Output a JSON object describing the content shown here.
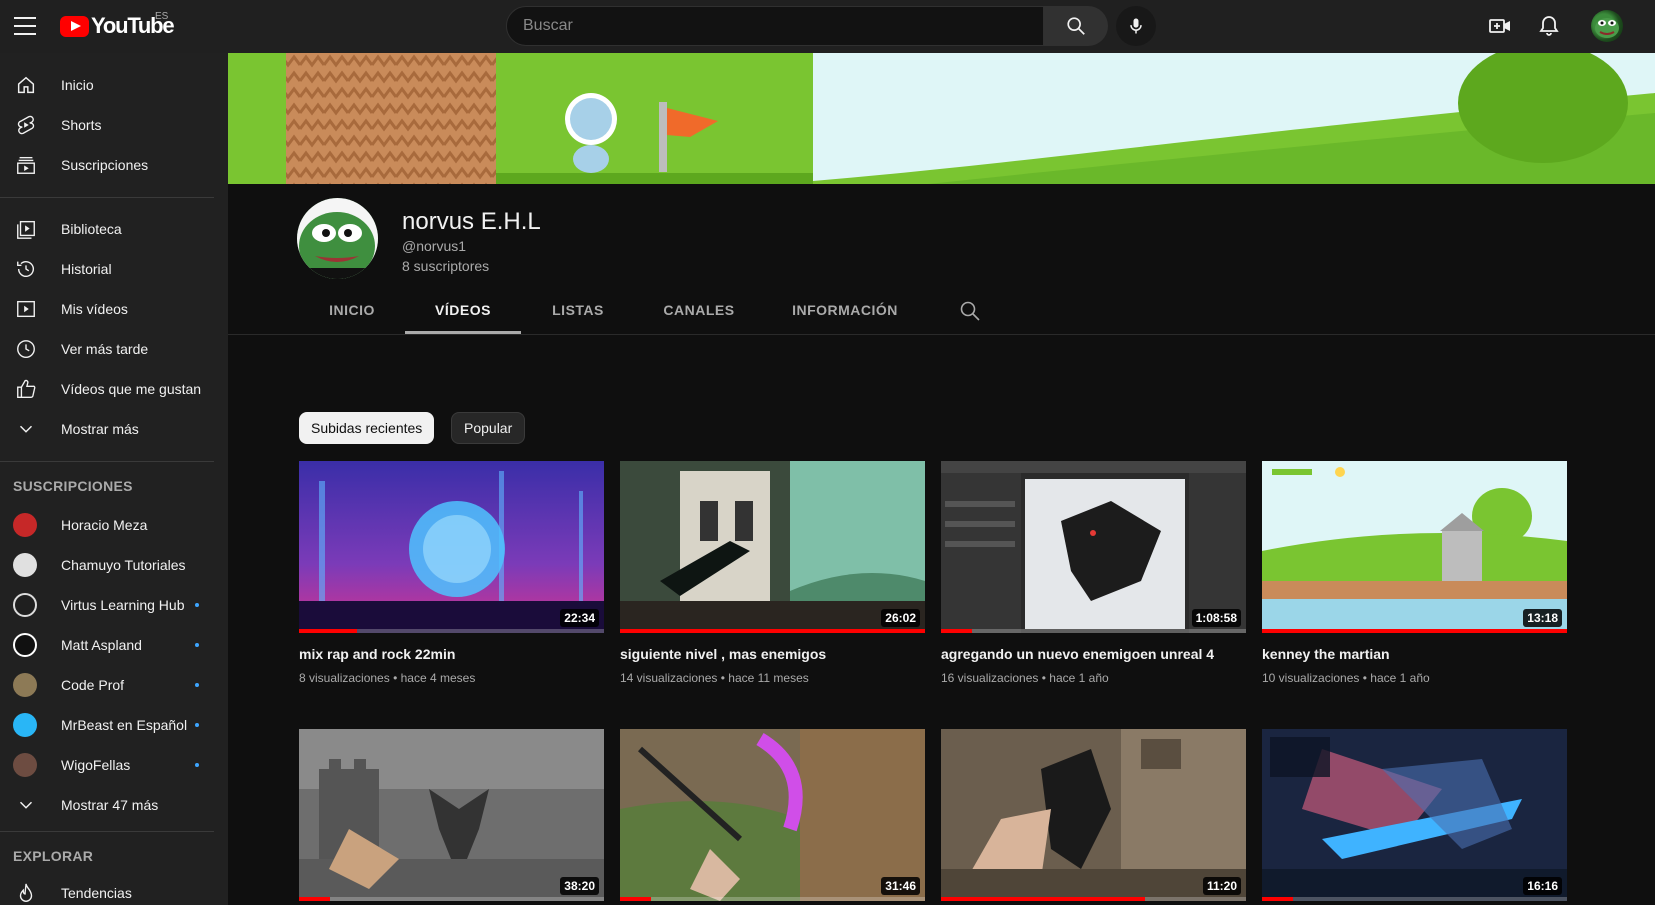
{
  "topbar": {
    "logo_text": "YouTube",
    "country_code": "ES",
    "search_placeholder": "Buscar",
    "icons": [
      "menu-icon",
      "search-icon",
      "mic-icon",
      "create-video-icon",
      "bell-icon",
      "account-avatar"
    ]
  },
  "sidebar": {
    "main": [
      {
        "label": "Inicio",
        "icon": "home-icon"
      },
      {
        "label": "Shorts",
        "icon": "shorts-icon"
      },
      {
        "label": "Suscripciones",
        "icon": "subscriptions-icon"
      }
    ],
    "library": [
      {
        "label": "Biblioteca",
        "icon": "library-icon"
      },
      {
        "label": "Historial",
        "icon": "history-icon"
      },
      {
        "label": "Mis vídeos",
        "icon": "my-videos-icon"
      },
      {
        "label": "Ver más tarde",
        "icon": "watch-later-icon"
      },
      {
        "label": "Vídeos que me gustan",
        "icon": "like-icon"
      },
      {
        "label": "Mostrar más",
        "icon": "chevron-down-icon"
      }
    ],
    "subscriptions_title": "SUSCRIPCIONES",
    "subscriptions": [
      {
        "label": "Horacio Meza",
        "color": "#c62828",
        "dot": false
      },
      {
        "label": "Chamuyo Tutoriales",
        "color": "#e0e0e0",
        "dot": false
      },
      {
        "label": "Virtus Learning Hub",
        "color": "#1f1f1f",
        "dot": true
      },
      {
        "label": "Matt Aspland",
        "color": "#ffffff",
        "dot": true
      },
      {
        "label": "Code Prof",
        "color": "#8d7a56",
        "dot": true
      },
      {
        "label": "MrBeast en Español",
        "color": "#29b6f6",
        "dot": true
      },
      {
        "label": "WigoFellas",
        "color": "#6d4c41",
        "dot": true
      }
    ],
    "show_more_subs": "Mostrar 47 más",
    "explore_title": "EXPLORAR",
    "explore": [
      {
        "label": "Tendencias",
        "icon": "trending-icon"
      }
    ]
  },
  "channel": {
    "name": "norvus E.H.L",
    "handle": "@norvus1",
    "subscribers": "8 suscriptores",
    "tabs": [
      {
        "label": "INICIO",
        "active": false
      },
      {
        "label": "VÍDEOS",
        "active": true
      },
      {
        "label": "LISTAS",
        "active": false
      },
      {
        "label": "CANALES",
        "active": false
      },
      {
        "label": "INFORMACIÓN",
        "active": false
      }
    ]
  },
  "filters": {
    "chips": [
      {
        "label": "Subidas recientes",
        "selected": true
      },
      {
        "label": "Popular",
        "selected": false
      }
    ]
  },
  "videos": [
    {
      "title": "mix rap and rock 22min",
      "duration": "22:34",
      "views": "8 visualizaciones",
      "age": "hace 4 meses",
      "watched": 0.19
    },
    {
      "title": "siguiente nivel , mas enemigos",
      "duration": "26:02",
      "views": "14 visualizaciones",
      "age": "hace 11 meses",
      "watched": 1.0
    },
    {
      "title": "agregando un nuevo enemigoen unreal 4",
      "duration": "1:08:58",
      "views": "16 visualizaciones",
      "age": "hace 1 año",
      "watched": 0.1
    },
    {
      "title": "kenney the martian",
      "duration": "13:18",
      "views": "10 visualizaciones",
      "age": "hace 1 año",
      "watched": 1.0
    },
    {
      "title": "",
      "duration": "38:20",
      "views": "",
      "age": "",
      "watched": 0.1
    },
    {
      "title": "",
      "duration": "31:46",
      "views": "",
      "age": "",
      "watched": 0.1
    },
    {
      "title": "",
      "duration": "11:20",
      "views": "",
      "age": "",
      "watched": 0.67
    },
    {
      "title": "",
      "duration": "16:16",
      "views": "",
      "age": "",
      "watched": 0.1
    }
  ],
  "meta_separator": "•"
}
